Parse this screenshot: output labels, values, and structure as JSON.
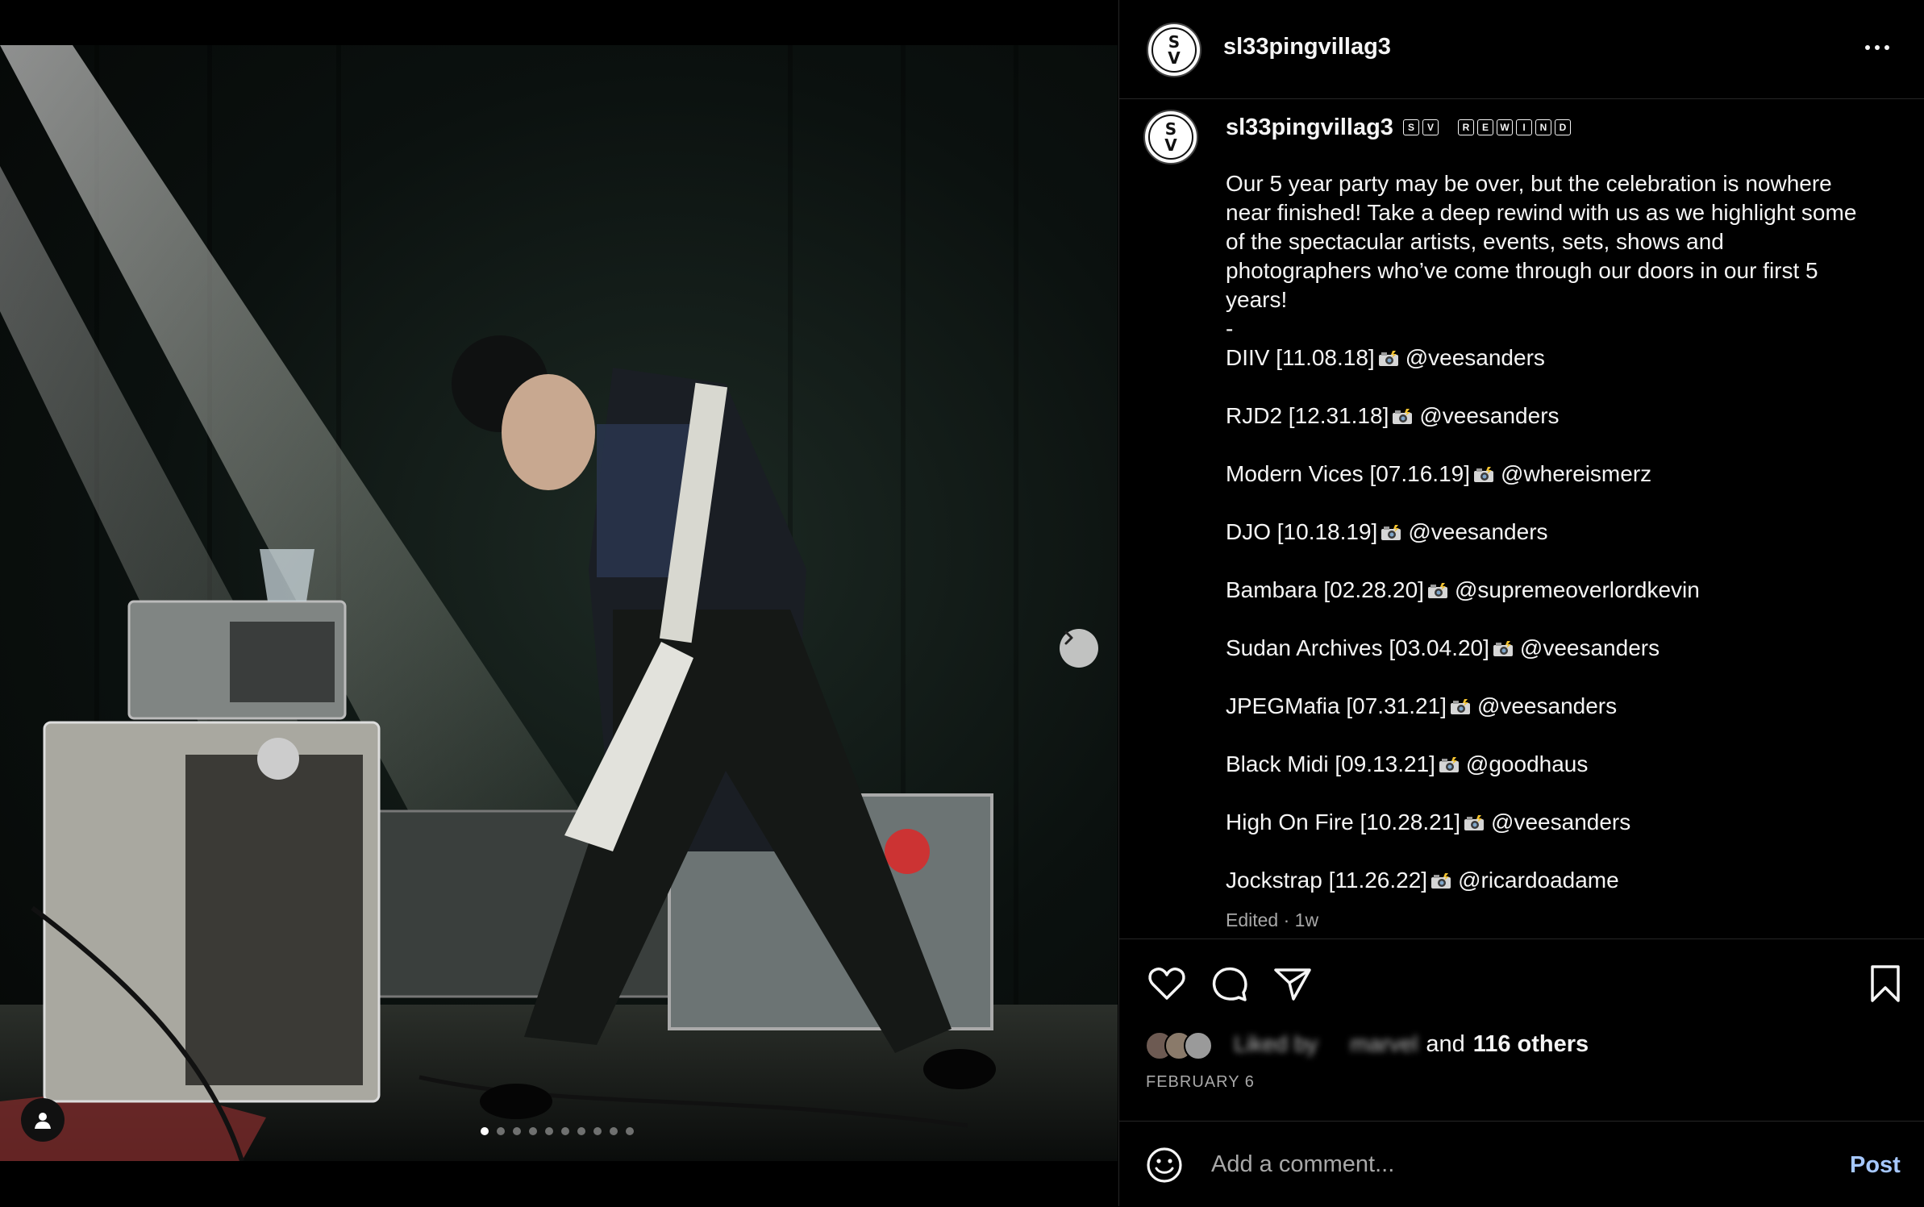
{
  "post": {
    "username": "sl33pingvillag3",
    "avatar_letters": [
      "S",
      "V"
    ],
    "rewind_letters": [
      "S",
      "V",
      "",
      "R",
      "E",
      "W",
      "I",
      "N",
      "D"
    ],
    "caption_intro": "Our 5 year party may be over, but the celebration is nowhere near finished! Take a deep rewind with us as we highlight some of the spectacular artists, events, sets, shows and photographers who’ve come through our doors in our first 5 years!",
    "caption_dash": "-",
    "caption_entries": [
      {
        "show": "DIIV [11.08.18]",
        "credit": "@veesanders"
      },
      {
        "show": "RJD2 [12.31.18]",
        "credit": "@veesanders"
      },
      {
        "show": "Modern Vices [07.16.19]",
        "credit": "@whereismerz"
      },
      {
        "show": "DJO [10.18.19]",
        "credit": "@veesanders"
      },
      {
        "show": "Bambara [02.28.20]",
        "credit": "@supremeoverlordkevin"
      },
      {
        "show": "Sudan Archives [03.04.20]",
        "credit": "@veesanders"
      },
      {
        "show": "JPEGMafia [07.31.21]",
        "credit": "@veesanders"
      },
      {
        "show": "Black Midi [09.13.21]",
        "credit": "@goodhaus"
      },
      {
        "show": "High On Fire [10.28.21]",
        "credit": "@veesanders"
      },
      {
        "show": "Jockstrap [11.26.22]",
        "credit": "@ricardoadame"
      }
    ],
    "edited_label": "Edited · 1w",
    "liked_by_prefix": "Liked by",
    "liked_by_user": "marvel",
    "liked_and": "and",
    "liked_others": "116 others",
    "date": "FEBRUARY 6"
  },
  "carousel": {
    "slide_count": 10,
    "active_index": 0
  },
  "comment": {
    "placeholder": "Add a comment...",
    "post_label": "Post"
  },
  "icons": {
    "more": "more-horizontal-icon",
    "like": "heart-icon",
    "comment": "comment-bubble-icon",
    "share": "paper-plane-icon",
    "save": "bookmark-icon",
    "emoji": "smiley-icon",
    "next": "chevron-right-icon",
    "tags": "user-tag-icon",
    "camera_emoji": "camera-flash-emoji"
  },
  "colors": {
    "background": "#000000",
    "text": "#f5f5f5",
    "secondary_text": "#a8a8a8",
    "divider": "#262626",
    "post_button": "#a6c8ff"
  }
}
